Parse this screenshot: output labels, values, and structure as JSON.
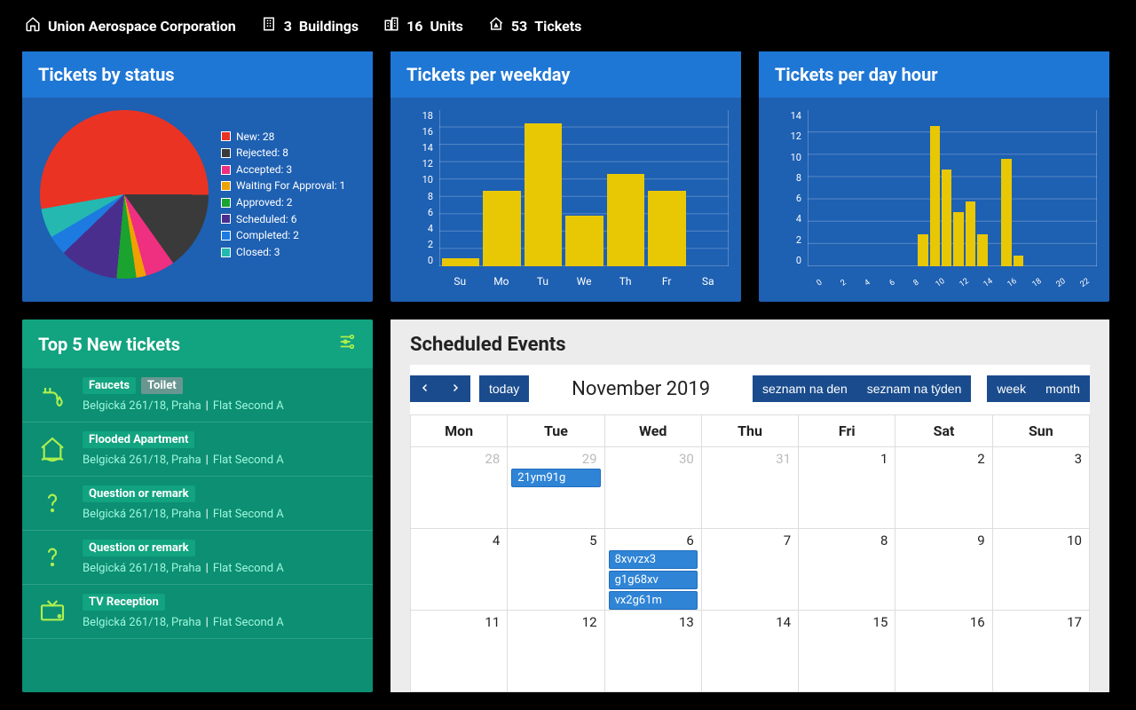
{
  "header": {
    "company": "Union Aerospace Corporation",
    "buildings_count": "3",
    "buildings_label": "Buildings",
    "units_count": "16",
    "units_label": "Units",
    "tickets_count": "53",
    "tickets_label": "Tickets"
  },
  "statusCard": {
    "title": "Tickets by status"
  },
  "weekdayCard": {
    "title": "Tickets per weekday"
  },
  "hourCard": {
    "title": "Tickets per day hour"
  },
  "chart_data": [
    {
      "type": "pie",
      "title": "Tickets by status",
      "series": [
        {
          "name": "New",
          "value": 28,
          "color": "#eb3323"
        },
        {
          "name": "Rejected",
          "value": 8,
          "color": "#3a3a3a"
        },
        {
          "name": "Accepted",
          "value": 3,
          "color": "#ef2f80"
        },
        {
          "name": "Waiting For Approval",
          "value": 1,
          "color": "#f0a102"
        },
        {
          "name": "Approved",
          "value": 2,
          "color": "#1aa32f"
        },
        {
          "name": "Scheduled",
          "value": 6,
          "color": "#4a2e8e"
        },
        {
          "name": "Completed",
          "value": 2,
          "color": "#1c7ae0"
        },
        {
          "name": "Closed",
          "value": 3,
          "color": "#24b8b0"
        }
      ]
    },
    {
      "type": "bar",
      "title": "Tickets per weekday",
      "categories": [
        "Su",
        "Mo",
        "Tu",
        "We",
        "Th",
        "Fr",
        "Sa"
      ],
      "values": [
        1,
        9,
        17,
        6,
        11,
        9,
        0
      ],
      "ylim": [
        0,
        18
      ],
      "ystep": 2
    },
    {
      "type": "bar",
      "title": "Tickets per day hour",
      "categories": [
        "0",
        "2",
        "4",
        "6",
        "8",
        "10",
        "12",
        "14",
        "16",
        "18",
        "20",
        "22"
      ],
      "x": [
        0,
        1,
        2,
        3,
        4,
        5,
        6,
        7,
        8,
        9,
        10,
        11,
        12,
        13,
        14,
        15,
        16,
        17,
        18,
        19,
        20,
        21,
        22,
        23
      ],
      "values": [
        0,
        0,
        0,
        0,
        0,
        0,
        0,
        0,
        0,
        3,
        13,
        9,
        5,
        6,
        3,
        0,
        10,
        1,
        0,
        0,
        0,
        0,
        0,
        0
      ],
      "ylim": [
        0,
        14
      ],
      "ystep": 2
    }
  ],
  "topNew": {
    "title": "Top 5 New tickets",
    "items": [
      {
        "tags": [
          "Faucets",
          "Toilet"
        ],
        "icon": "faucet",
        "address": "Belgická 261/18, Praha",
        "unit": "Flat Second A"
      },
      {
        "tags": [
          "Flooded Apartment"
        ],
        "icon": "house",
        "address": "Belgická 261/18, Praha",
        "unit": "Flat Second A"
      },
      {
        "tags": [
          "Question or remark"
        ],
        "icon": "question",
        "address": "Belgická 261/18, Praha",
        "unit": "Flat Second A"
      },
      {
        "tags": [
          "Question or remark"
        ],
        "icon": "question",
        "address": "Belgická 261/18, Praha",
        "unit": "Flat Second A"
      },
      {
        "tags": [
          "TV Reception"
        ],
        "icon": "tv",
        "address": "Belgická 261/18, Praha",
        "unit": "Flat Second A"
      }
    ]
  },
  "calendar": {
    "title": "Scheduled Events",
    "today": "today",
    "month_label": "November 2019",
    "view_buttons": {
      "list_day": "seznam na den",
      "list_week": "seznam na týden",
      "week": "week",
      "month": "month"
    },
    "weekdays": [
      "Mon",
      "Tue",
      "Wed",
      "Thu",
      "Fri",
      "Sat",
      "Sun"
    ],
    "weeks": [
      [
        {
          "n": "28",
          "muted": true,
          "events": []
        },
        {
          "n": "29",
          "muted": true,
          "events": [
            "21ym91g"
          ]
        },
        {
          "n": "30",
          "muted": true,
          "events": []
        },
        {
          "n": "31",
          "muted": true,
          "events": []
        },
        {
          "n": "1",
          "events": []
        },
        {
          "n": "2",
          "events": []
        },
        {
          "n": "3",
          "events": []
        }
      ],
      [
        {
          "n": "4",
          "events": []
        },
        {
          "n": "5",
          "events": []
        },
        {
          "n": "6",
          "events": [
            "8xvvzx3",
            "g1g68xv",
            "vx2g61m"
          ]
        },
        {
          "n": "7",
          "events": []
        },
        {
          "n": "8",
          "events": []
        },
        {
          "n": "9",
          "events": []
        },
        {
          "n": "10",
          "events": []
        }
      ],
      [
        {
          "n": "11",
          "events": []
        },
        {
          "n": "12",
          "events": []
        },
        {
          "n": "13",
          "events": []
        },
        {
          "n": "14",
          "events": []
        },
        {
          "n": "15",
          "events": []
        },
        {
          "n": "16",
          "events": []
        },
        {
          "n": "17",
          "events": []
        }
      ]
    ]
  }
}
